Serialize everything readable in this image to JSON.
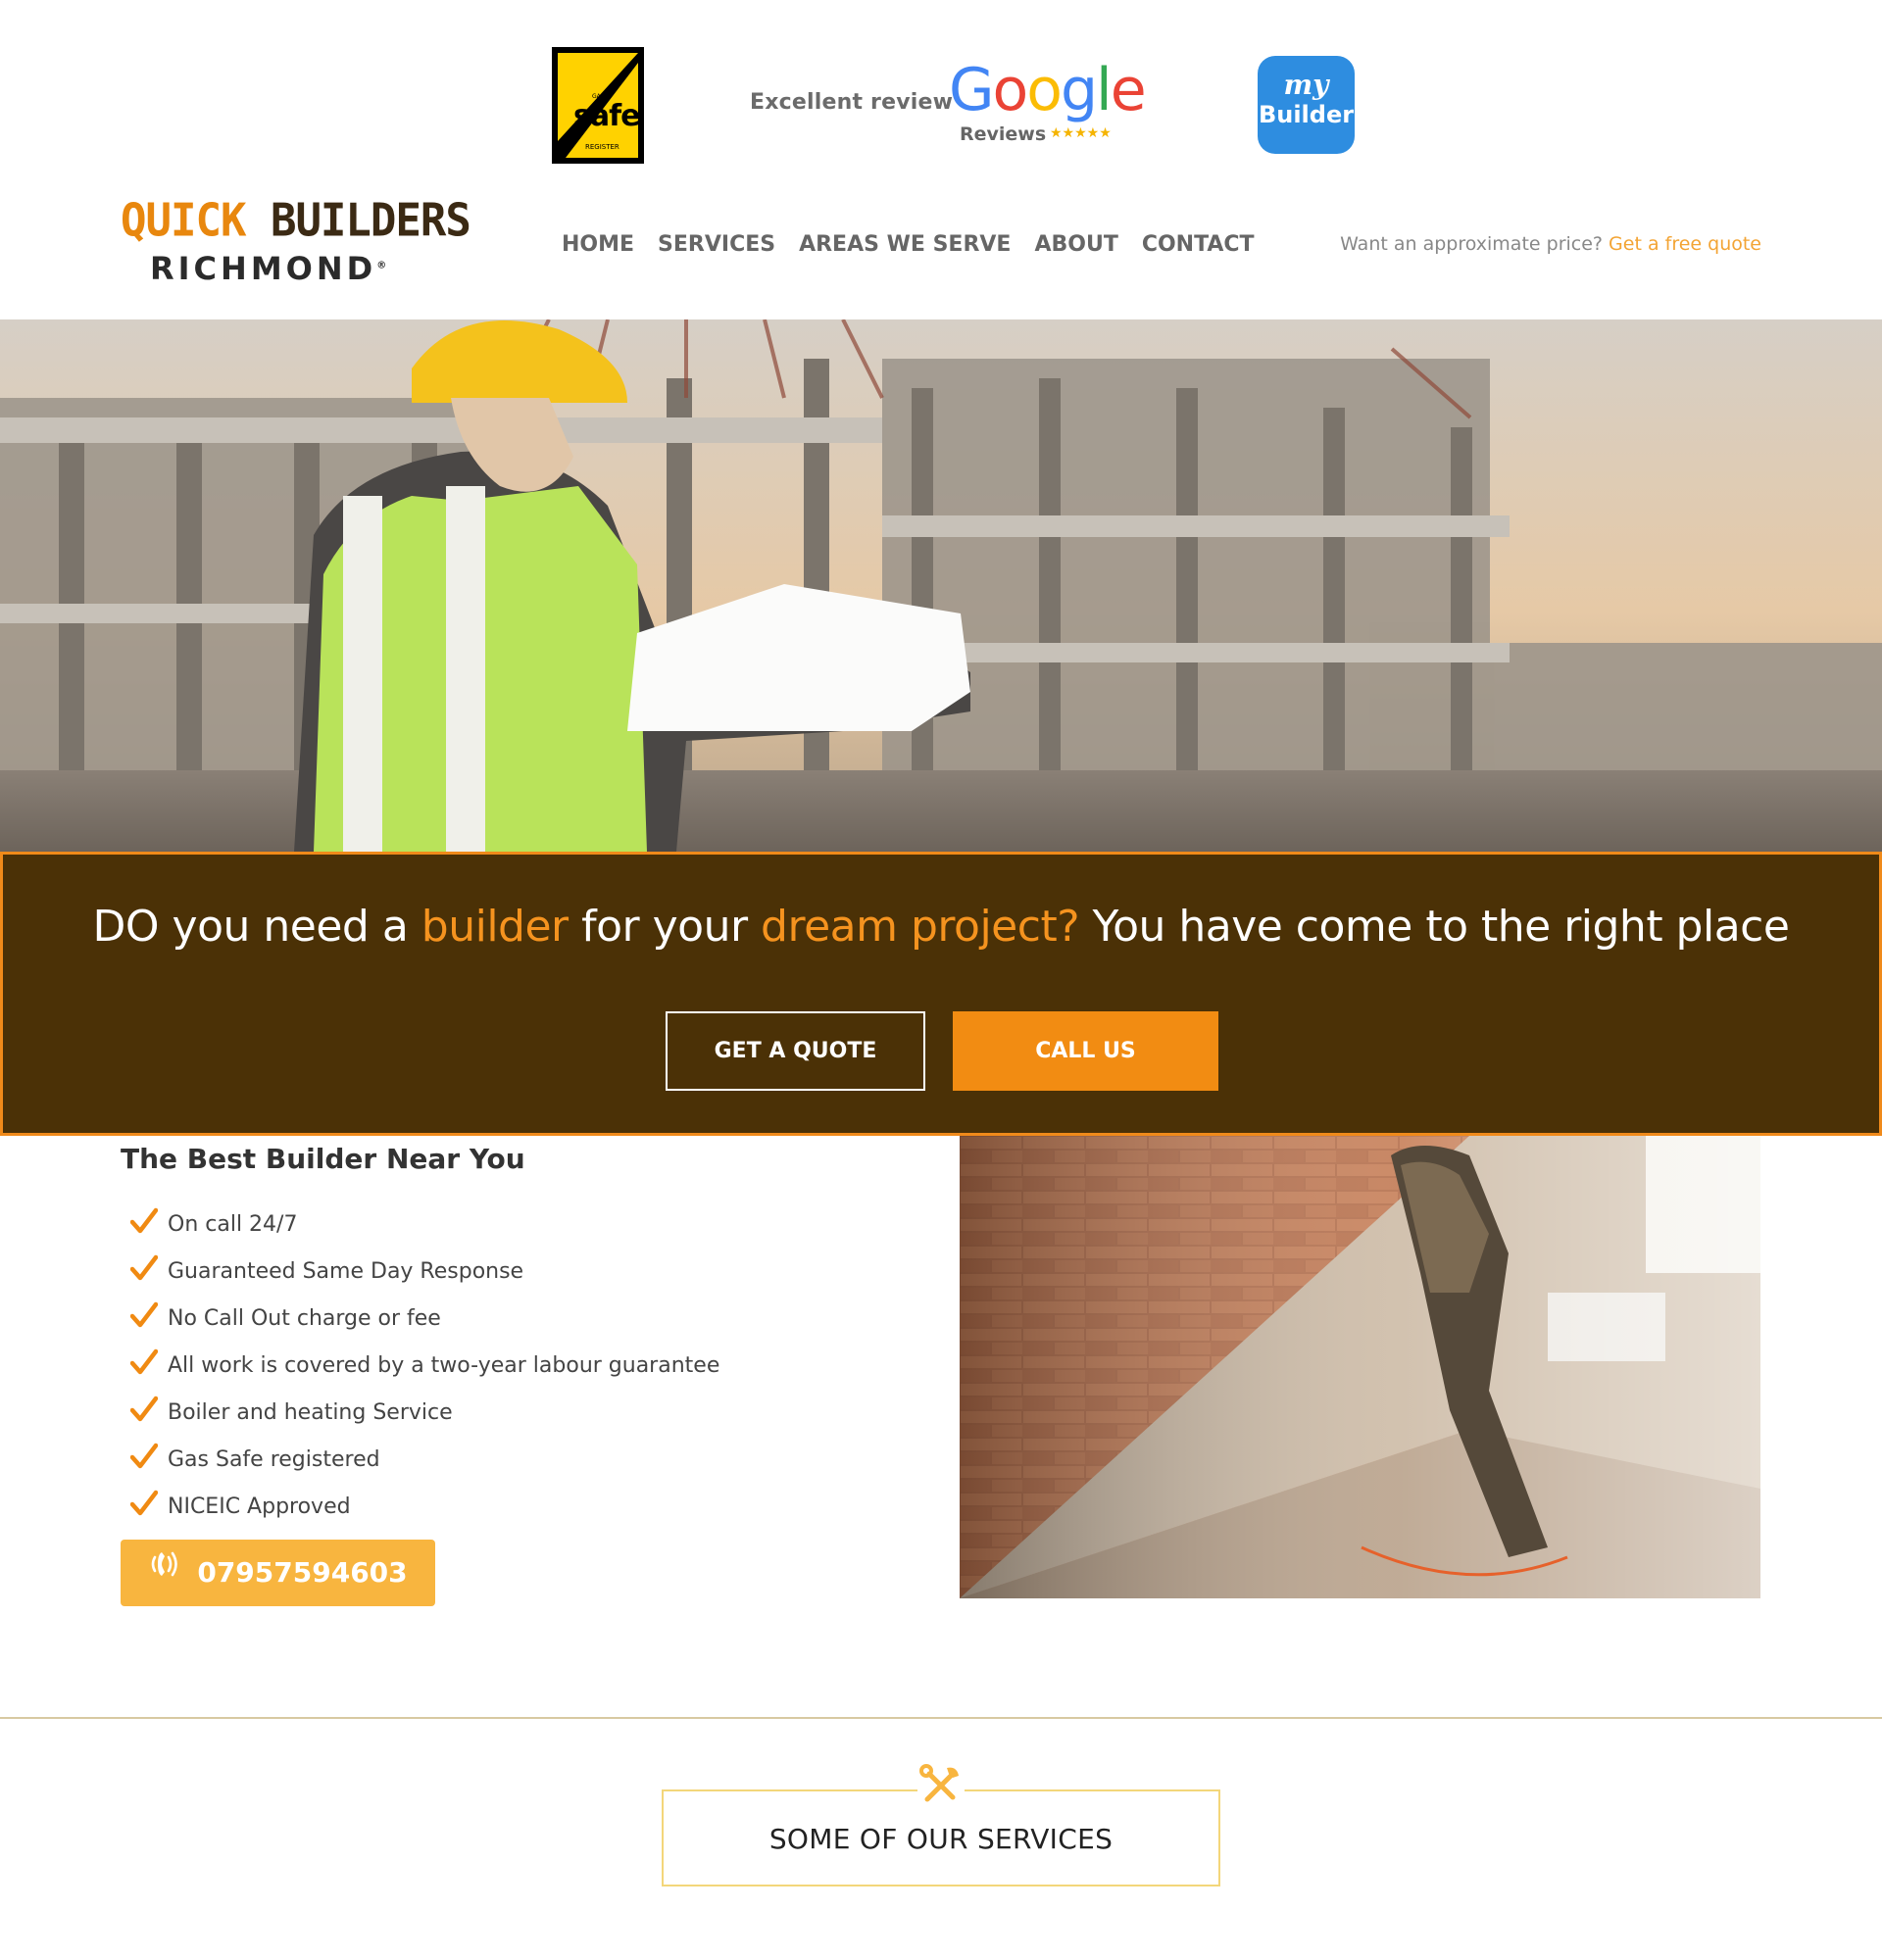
{
  "badges": {
    "gassafe": {
      "gas": "GAS",
      "word": "safe",
      "register": "REGISTER"
    },
    "google": {
      "excellent": "Excellent review",
      "logo": "Google",
      "reviews": "Reviews",
      "stars": "★★★★★"
    },
    "mybuilder": {
      "my": "my",
      "builder": "Builder"
    }
  },
  "logo": {
    "line1_a": "QUICK",
    "line1_b": "BUILDERS",
    "line2": "RICHMOND",
    "reg": "®"
  },
  "nav": {
    "items": [
      "HOME",
      "SERVICES",
      "AREAS WE SERVE",
      "ABOUT",
      "CONTACT"
    ]
  },
  "quote_tag": {
    "text": "Want an approximate price? ",
    "link": "Get a free quote"
  },
  "cta": {
    "h_1": "DO you need a ",
    "h_2": "builder",
    "h_3": " for your ",
    "h_4": "dream project?",
    "h_5": " You have come to the right place",
    "btn_quote": "GET A QUOTE",
    "btn_call": "CALL US"
  },
  "features": {
    "title": "The Best Builder Near You",
    "items": [
      "On call 24/7",
      "Guaranteed Same Day Response",
      "No Call Out charge or fee",
      "All work is covered by a two-year labour guarantee",
      "Boiler and heating Service",
      "Gas Safe registered",
      "NICEIC Approved"
    ],
    "phone": "07957594603"
  },
  "services": {
    "title": "SOME OF OUR SERVICES"
  },
  "colors": {
    "accent": "#f28c12",
    "band": "#4b3106",
    "light_accent": "#f8b53f"
  },
  "icons": [
    "gas-safe-logo",
    "google-reviews-logo",
    "mybuilder-logo",
    "check-icon",
    "phone-icon",
    "tools-icon"
  ]
}
